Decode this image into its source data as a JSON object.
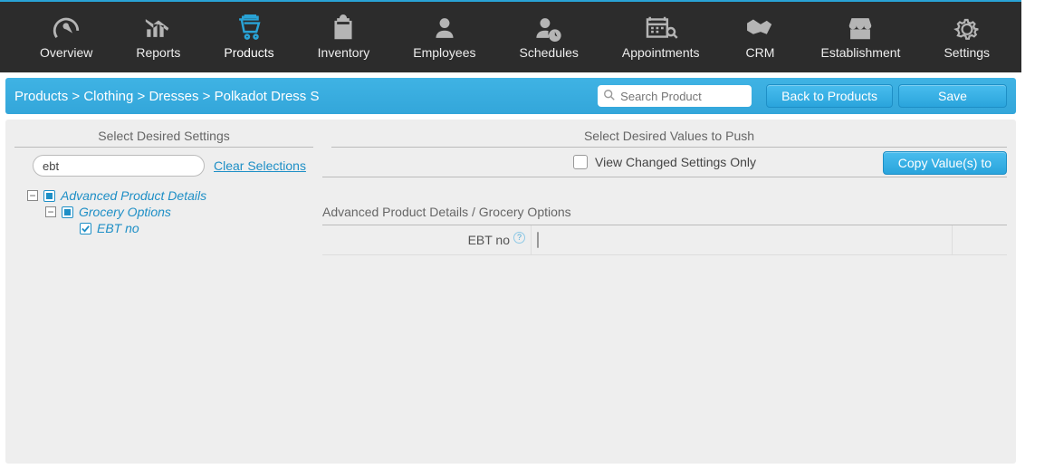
{
  "nav": {
    "items": [
      {
        "label": "Overview"
      },
      {
        "label": "Reports"
      },
      {
        "label": "Products"
      },
      {
        "label": "Inventory"
      },
      {
        "label": "Employees"
      },
      {
        "label": "Schedules"
      },
      {
        "label": "Appointments"
      },
      {
        "label": "CRM"
      },
      {
        "label": "Establishment"
      },
      {
        "label": "Settings"
      }
    ],
    "active_index": 2
  },
  "breadcrumb": {
    "parts": [
      "Products",
      "Clothing",
      "Dresses",
      "Polkadot Dress S"
    ],
    "sep": " > "
  },
  "bluebar": {
    "search_placeholder": "Search Product",
    "back_label": "Back to Products",
    "save_label": "Save"
  },
  "left": {
    "title": "Select Desired Settings",
    "filter_value": "ebt",
    "clear_label": "Clear Selections",
    "tree": {
      "n0": {
        "label": "Advanced Product Details"
      },
      "n1": {
        "label": "Grocery Options"
      },
      "n2": {
        "label": "EBT no"
      }
    }
  },
  "right": {
    "title": "Select Desired Values to Push",
    "changed_only_label": "View Changed Settings Only",
    "copy_label": "Copy Value(s) to",
    "subheader": "Advanced Product Details / Grocery Options",
    "field0_label": "EBT no"
  }
}
